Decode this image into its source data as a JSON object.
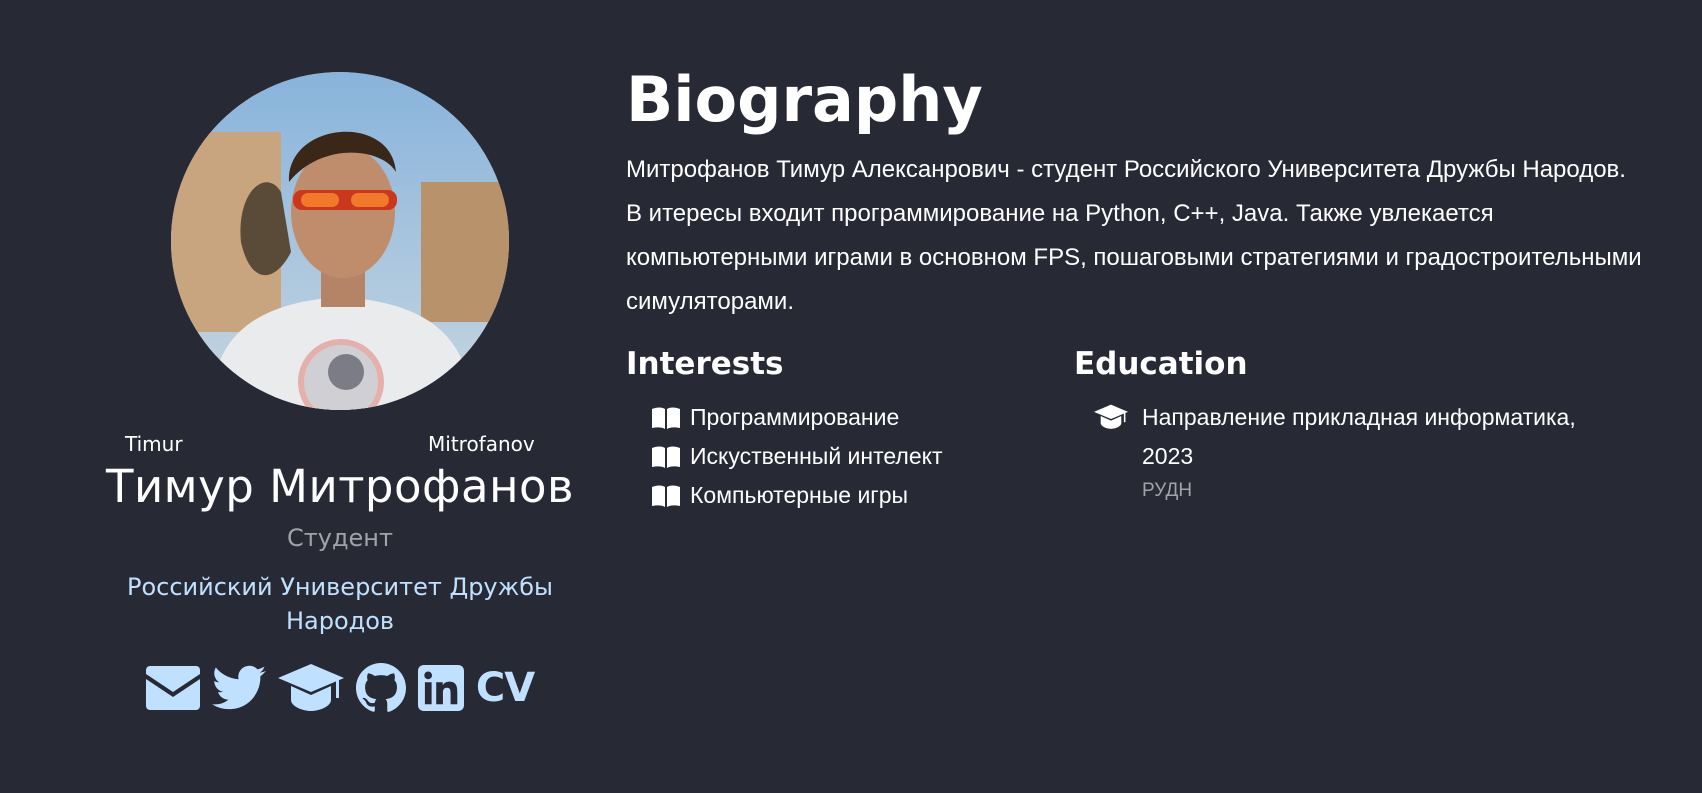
{
  "profile": {
    "first_name_en": "Timur",
    "last_name_en": "Mitrofanov",
    "full_name": "Тимур Митрофанов",
    "role": "Студент",
    "organization": "Российский Университет Дружбы Народов",
    "social": [
      {
        "icon": "envelope-icon",
        "label": "email"
      },
      {
        "icon": "twitter-icon",
        "label": "twitter"
      },
      {
        "icon": "graduation-cap-icon",
        "label": "scholar"
      },
      {
        "icon": "github-icon",
        "label": "github"
      },
      {
        "icon": "linkedin-icon",
        "label": "linkedin"
      },
      {
        "icon": "cv-icon",
        "label": "CV"
      }
    ]
  },
  "biography": {
    "title": "Biography",
    "text": "Митрофанов Тимур Алексанрович - студент Российского Университета Дружбы Народов. В итересы входит программирование на Python, C++, Java. Также увлекается компьютерными играми в основном FPS, пошаговыми стратегиями и градостроительными симуляторами."
  },
  "interests": {
    "title": "Interests",
    "items": [
      "Программирование",
      "Искуственный интелект",
      "Компьютерные игры"
    ]
  },
  "education": {
    "title": "Education",
    "items": [
      {
        "course": "Направление прикладная информатика, 2023",
        "institution": "РУДН"
      }
    ]
  },
  "colors": {
    "background": "#272935",
    "accent": "#bfe0ff",
    "muted": "#a0a3a8",
    "text": "#ffffff"
  }
}
